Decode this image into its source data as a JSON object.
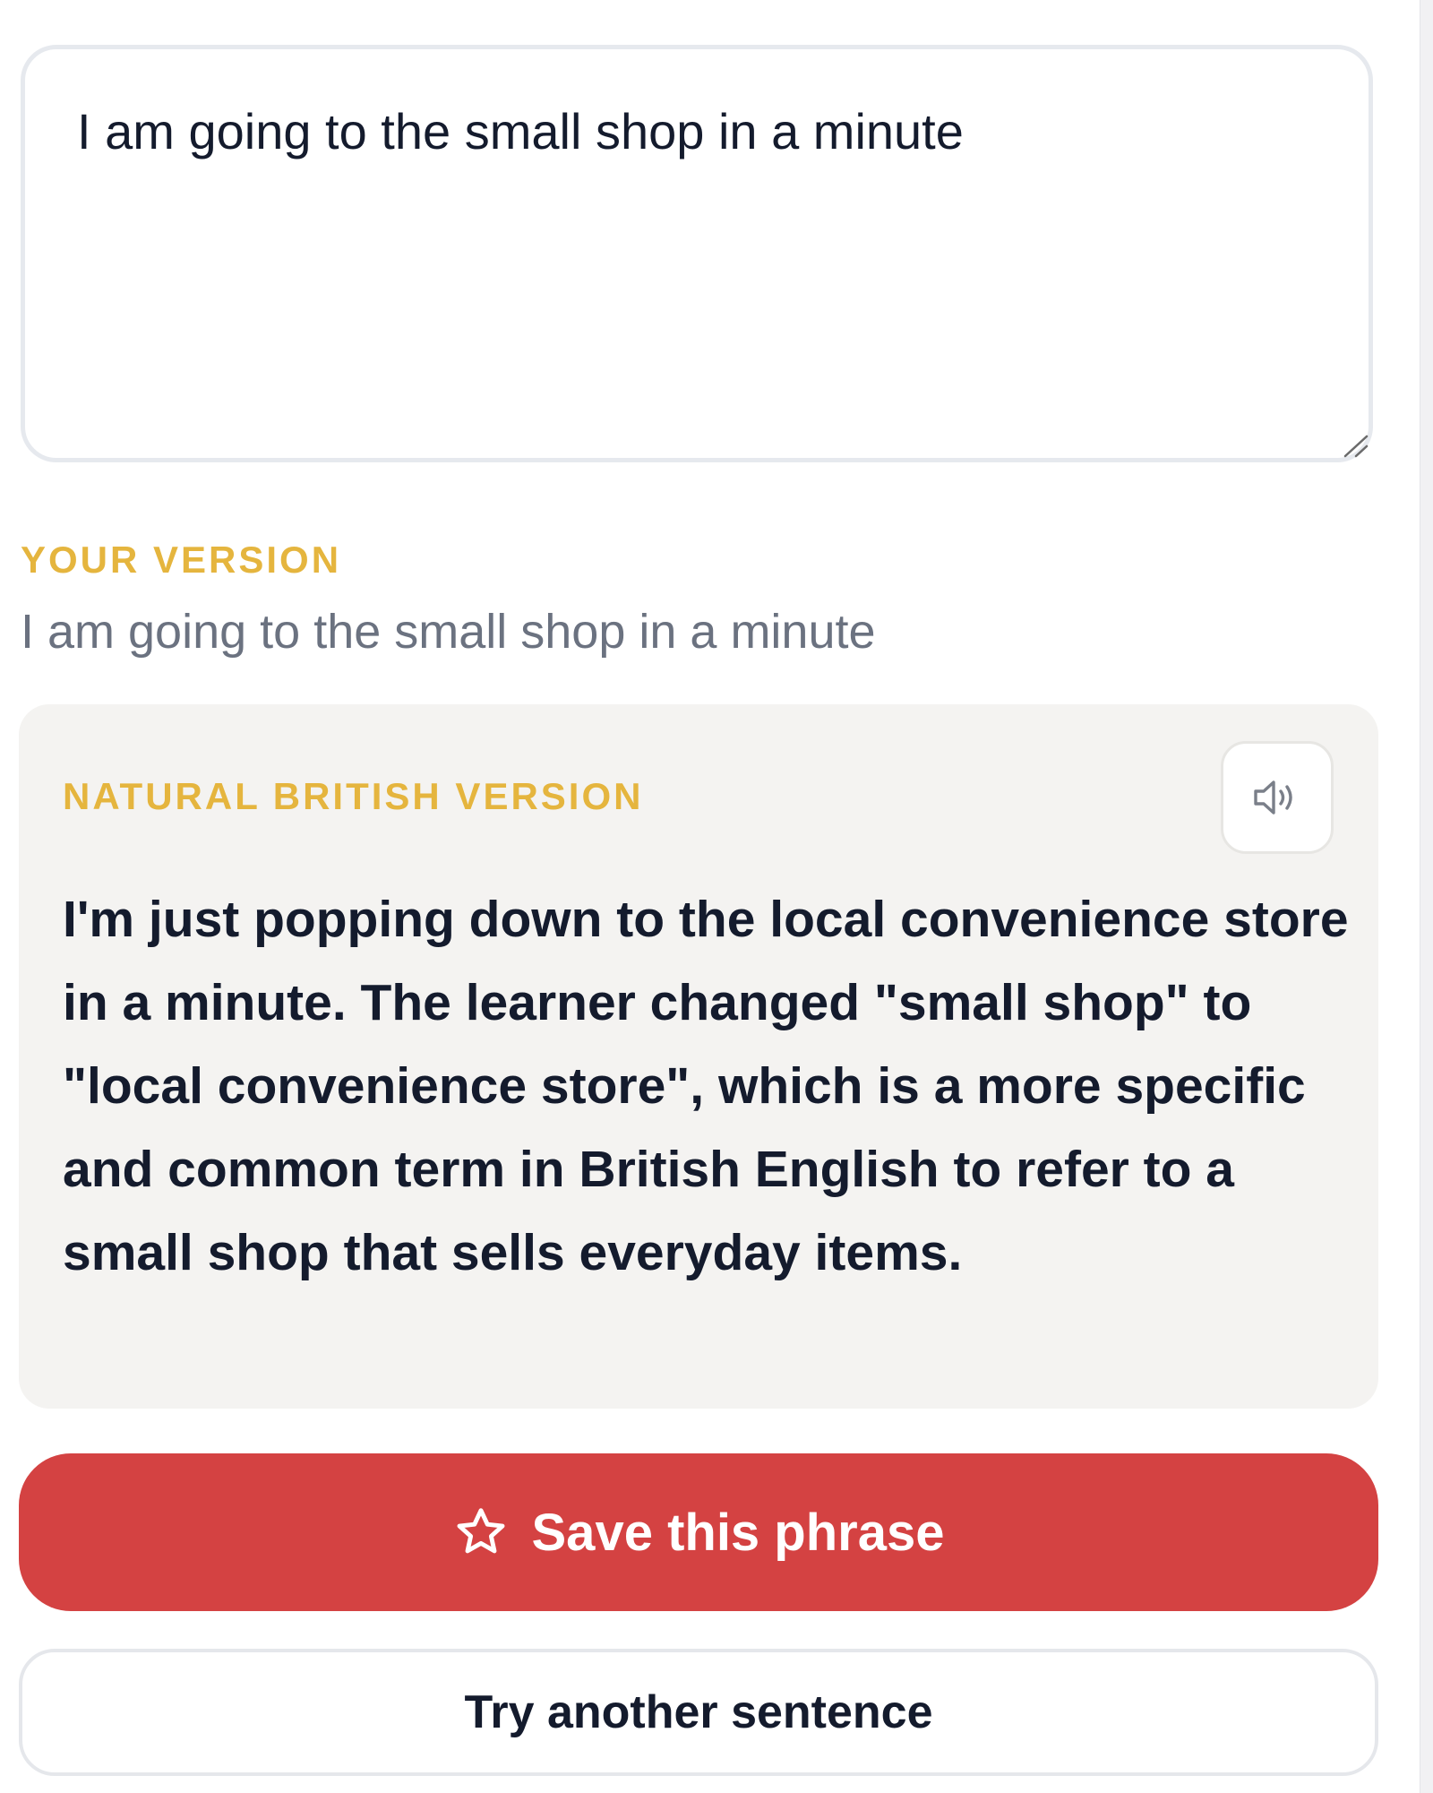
{
  "input": {
    "value": "I am going to the small shop in a minute"
  },
  "your_version": {
    "label": "YOUR VERSION",
    "text": "I am going to the small shop in a minute"
  },
  "natural_version": {
    "label": "NATURAL BRITISH VERSION",
    "text": "I'm just popping down to the local convenience store in a minute. The learner changed \"small shop\" to \"local convenience store\", which is a more specific and common term in British English to refer to a small shop that sells everyday items.",
    "speaker_icon": "speaker-icon"
  },
  "actions": {
    "save_label": "Save this phrase",
    "save_icon": "star-icon",
    "try_label": "Try another sentence"
  },
  "colors": {
    "accent_label": "#e5b53e",
    "save_button": "#d44242",
    "card_background": "#f4f3f1",
    "muted_text": "#6b7280",
    "primary_text": "#141b2d"
  }
}
